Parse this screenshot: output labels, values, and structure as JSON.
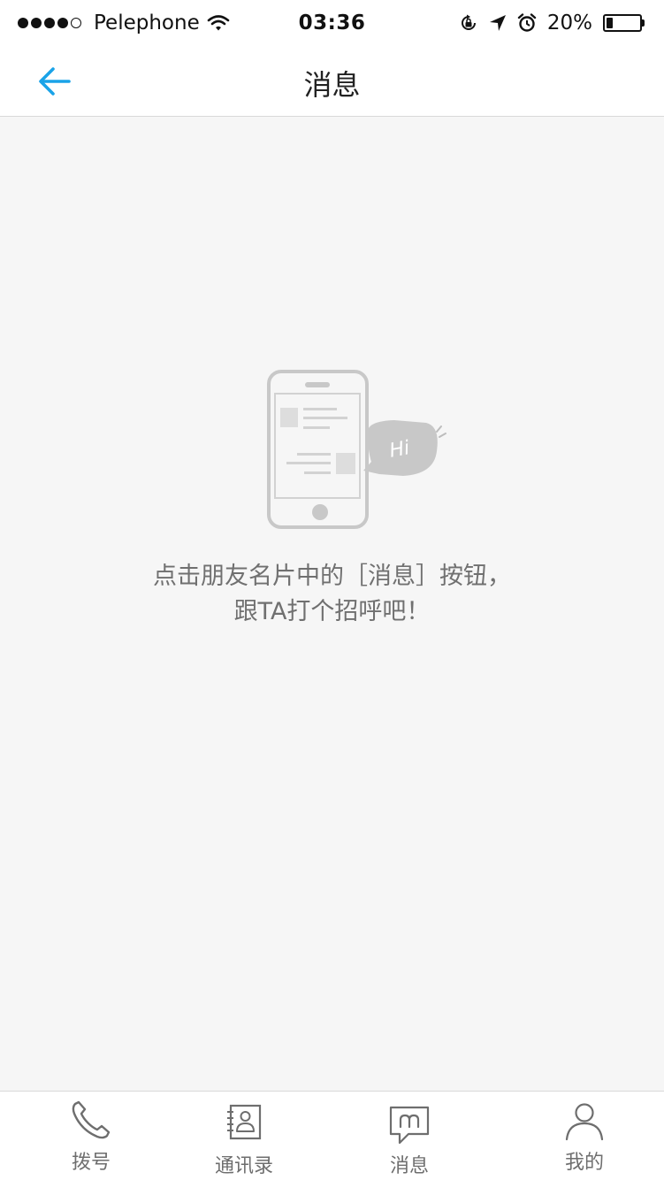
{
  "status_bar": {
    "carrier": "Pelephone",
    "time": "03:36",
    "battery_text": "20%",
    "battery_level": 0.2
  },
  "nav": {
    "title": "消息",
    "back_icon": "arrow-left-icon"
  },
  "empty_state": {
    "illustration_badge": "Hi",
    "message_line1": "点击朋友名片中的［消息］按钮，",
    "message_line2": "跟TA打个招呼吧！"
  },
  "tabs": [
    {
      "label": "拨号",
      "icon": "phone-icon"
    },
    {
      "label": "通讯录",
      "icon": "contacts-book-icon"
    },
    {
      "label": "消息",
      "icon": "message-bubble-icon"
    },
    {
      "label": "我的",
      "icon": "person-icon"
    }
  ],
  "colors": {
    "accent": "#1aa3e8",
    "background": "#f6f6f6",
    "text_secondary": "#707070"
  }
}
